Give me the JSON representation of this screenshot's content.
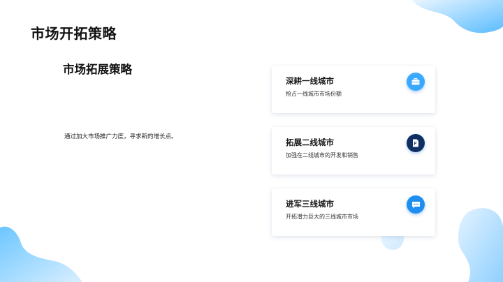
{
  "slide": {
    "title": "市场开拓策略",
    "subtitle": "市场拓展策略",
    "description": "通过加大市场推广力度，寻求新的增长点。"
  },
  "cards": [
    {
      "title": "深耕一线城市",
      "subtitle": "抢占一线城市市场份额",
      "icon": "briefcase-icon",
      "icon_color": "#39a8ff"
    },
    {
      "title": "拓展二线城市",
      "subtitle": "加强在二线城市的开发和销售",
      "icon": "document-icon",
      "icon_color": "#0f2f63"
    },
    {
      "title": "进军三线城市",
      "subtitle": "开拓潜力巨大的三线城市市场",
      "icon": "chat-bubble-icon",
      "icon_color": "#1e8ff0"
    }
  ],
  "colors": {
    "accent_light": "#39a8ff",
    "accent_dark": "#0f2f63",
    "blob": "#4fb4ff"
  }
}
